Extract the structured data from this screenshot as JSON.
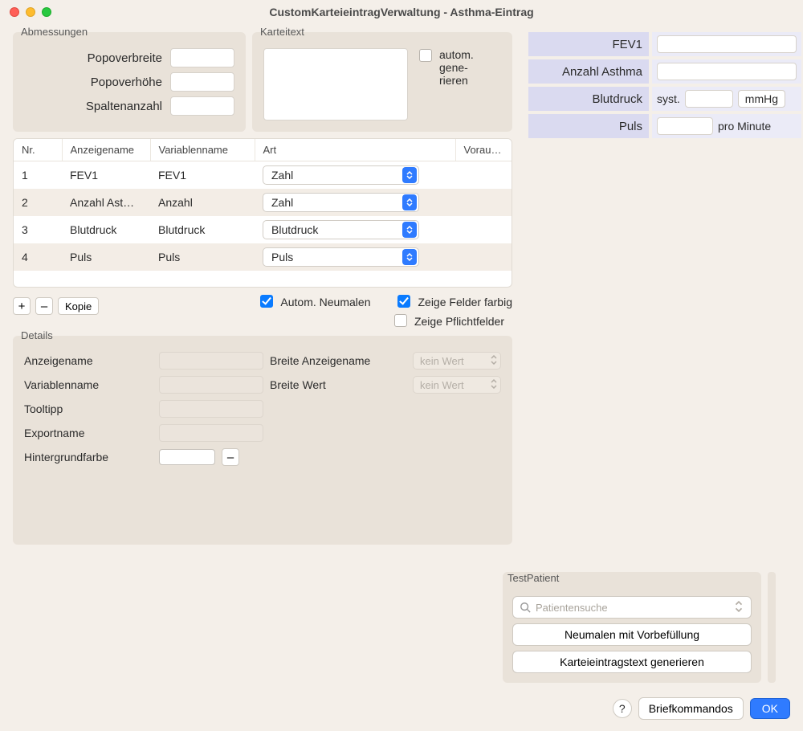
{
  "title": "CustomKarteieintragVerwaltung - Asthma-Eintrag",
  "panels": {
    "dimensions": {
      "legend": "Abmessungen",
      "popoverbreite_label": "Popoverbreite",
      "popoverhoehe_label": "Popoverhöhe",
      "spaltenanzahl_label": "Spaltenanzahl",
      "popoverbreite_value": "",
      "popoverhoehe_value": "",
      "spaltenanzahl_value": ""
    },
    "karteitext": {
      "legend": "Karteitext",
      "autogen_label": "autom. gene-rieren"
    },
    "details": {
      "legend": "Details",
      "anzeigename_label": "Anzeigename",
      "variablenname_label": "Variablenname",
      "tooltipp_label": "Tooltipp",
      "exportname_label": "Exportname",
      "hintergrundfarbe_label": "Hintergrundfarbe",
      "breite_anzeigename_label": "Breite Anzeigename",
      "breite_wert_label": "Breite Wert",
      "breite_anzeigename_value": "kein Wert",
      "breite_wert_value": "kein Wert"
    }
  },
  "table": {
    "headers": {
      "nr": "Nr.",
      "anzeigename": "Anzeigename",
      "variablenname": "Variablenname",
      "art": "Art",
      "vorausfuellen": "Voraus…"
    },
    "rows": [
      {
        "nr": "1",
        "anzeigename": "FEV1",
        "variablenname": "FEV1",
        "art": "Zahl"
      },
      {
        "nr": "2",
        "anzeigename": "Anzahl Ast…",
        "variablenname": "Anzahl",
        "art": "Zahl"
      },
      {
        "nr": "3",
        "anzeigename": "Blutdruck",
        "variablenname": "Blutdruck",
        "art": "Blutdruck"
      },
      {
        "nr": "4",
        "anzeigename": "Puls",
        "variablenname": "Puls",
        "art": "Puls"
      }
    ],
    "toolbar": {
      "add": "+",
      "remove": "–",
      "kopie": "Kopie",
      "autom_neumalen": "Autom. Neumalen",
      "zeige_farbig": "Zeige Felder farbig",
      "zeige_pflicht": "Zeige Pflichtfelder"
    }
  },
  "preview": {
    "rows": [
      {
        "label": "FEV1",
        "value_html": "input_full"
      },
      {
        "label": "Anzahl Asthma",
        "value_html": "input_full"
      },
      {
        "label": "Blutdruck",
        "value_html": "blutdruck"
      },
      {
        "label": "Puls",
        "value_html": "puls"
      }
    ],
    "blutdruck_prefix": "syst.",
    "blutdruck_unit": "mmHg",
    "puls_unit": "pro Minute"
  },
  "testpatient": {
    "legend": "TestPatient",
    "search_placeholder": "Patientensuche",
    "neumalen": "Neumalen mit Vorbefüllung",
    "generieren": "Karteieintragstext generieren"
  },
  "footer": {
    "help": "?",
    "briefkommandos": "Briefkommandos",
    "ok": "OK"
  }
}
